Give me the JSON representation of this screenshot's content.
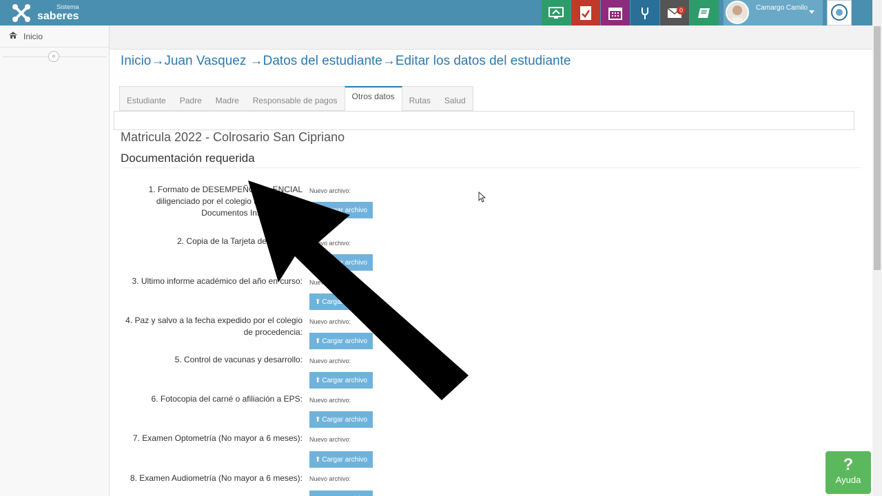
{
  "header": {
    "logo_small": "Sistema",
    "logo_big": "saberes",
    "icons": [
      {
        "name": "monitor-icon",
        "color": "#2e9c6a"
      },
      {
        "name": "checklist-icon",
        "color": "#c0392b"
      },
      {
        "name": "calendar-icon",
        "color": "#8e2b7c"
      },
      {
        "name": "fork-icon",
        "color": "#2a6f98"
      },
      {
        "name": "mail-icon",
        "color": "#555555",
        "badge": "0"
      },
      {
        "name": "book-icon",
        "color": "#2e9c6a"
      }
    ],
    "user_name": "Camargo Camilo"
  },
  "sidebar": {
    "items": [
      {
        "label": "Inicio",
        "icon": "home-icon"
      }
    ],
    "collapse_glyph": "«"
  },
  "main": {
    "breadcrumb": "Inicio→Juan Vasquez →Datos del estudiante→Editar los datos del estudiante",
    "tabs": [
      {
        "label": "Estudiante",
        "active": false
      },
      {
        "label": "Padre",
        "active": false
      },
      {
        "label": "Madre",
        "active": false
      },
      {
        "label": "Responsable de pagos",
        "active": false
      },
      {
        "label": "Otros datos",
        "active": true
      },
      {
        "label": "Rutas",
        "active": false
      },
      {
        "label": "Salud",
        "active": false
      }
    ],
    "matricula": "Matricula 2022 - Colrosario San Cipriano",
    "doc_title": "Documentación requerida",
    "nuevo_label": "Nuevo archivo:",
    "upload_label": "Cargar archivo",
    "documents": [
      {
        "label": "1. Formato de DESEMPEÑO C... ENCIAL diligenciado por el colegio anterior ... de Documentos Institucionales"
      },
      {
        "label": "2. Copia de la Tarjeta de identidad"
      },
      {
        "label": "3. Ultimo informe académico del año en curso:"
      },
      {
        "label": "4. Paz y salvo a la fecha expedido por el colegio de procedencia:"
      },
      {
        "label": "5. Control de vacunas y desarrollo:"
      },
      {
        "label": "6. Fotocopia del carné o afiliación a EPS:"
      },
      {
        "label": "7. Examen Optometría (No mayor a 6 meses):"
      },
      {
        "label": "8. Examen Audiometría (No mayor a 6 meses):"
      }
    ]
  },
  "help": {
    "glyph": "?",
    "label": "Ayuda"
  }
}
